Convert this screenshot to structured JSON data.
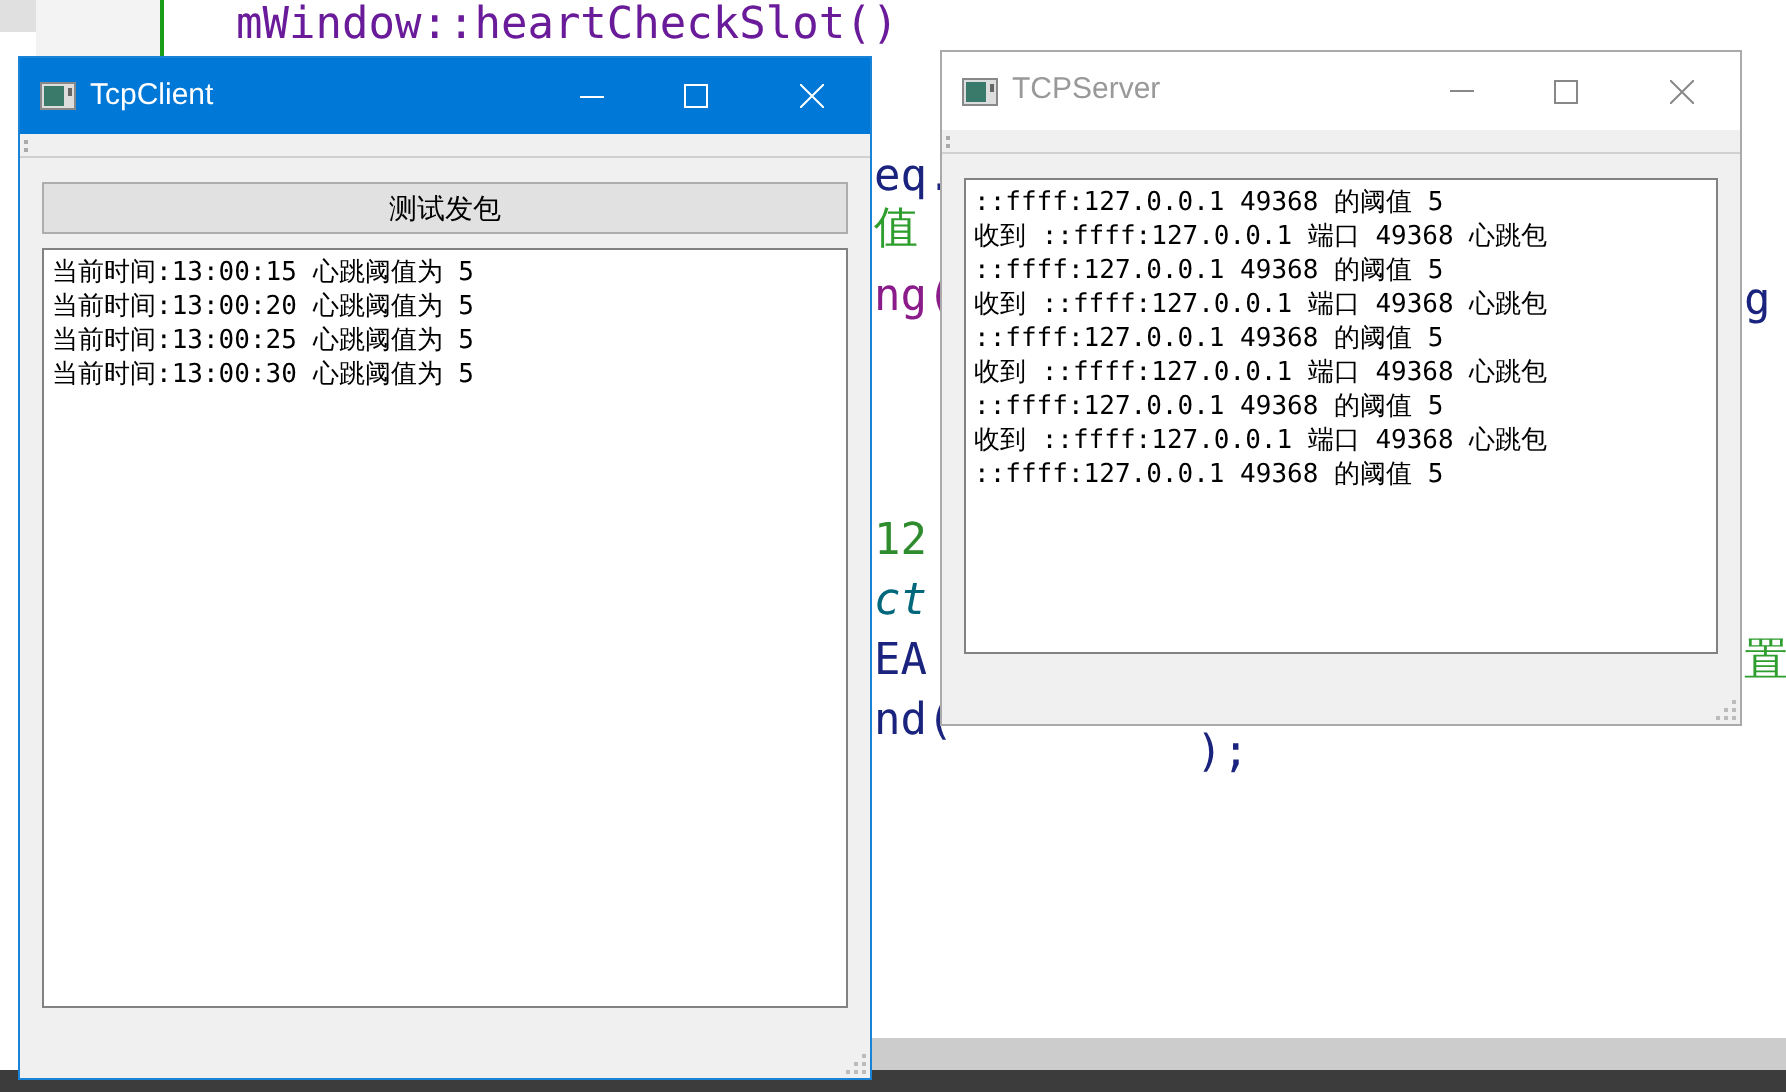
{
  "editor": {
    "code_fragments": [
      {
        "text": "mWindow::heartCheckSlot()",
        "color": "#6a1b9a",
        "italic": false
      },
      {
        "text": "eq.",
        "color": "#1a237e",
        "italic": false
      },
      {
        "text": "值",
        "color": "#2e9e2e",
        "italic": false
      },
      {
        "text": "ng(",
        "color": "#8b1a8b",
        "italic": false
      },
      {
        "text": "g",
        "color": "#1a237e",
        "italic": false
      },
      {
        "text": "12",
        "color": "#2e8b2e",
        "italic": false
      },
      {
        "text": "ct",
        "color": "#00677c",
        "italic": true
      },
      {
        "text": "EA",
        "color": "#1a237e",
        "italic": false
      },
      {
        "text": "置",
        "color": "#2e9e2e",
        "italic": false
      },
      {
        "text": "nd(",
        "color": "#1a237e",
        "italic": false
      },
      {
        "text": ");",
        "color": "#1a237e",
        "italic": false
      }
    ]
  },
  "windows": [
    {
      "title": "TcpClient",
      "active": true,
      "button": "测试发包",
      "log": [
        "当前时间:13:00:15 心跳阈值为 5",
        "当前时间:13:00:20 心跳阈值为 5",
        "当前时间:13:00:25 心跳阈值为 5",
        "当前时间:13:00:30 心跳阈值为 5"
      ]
    },
    {
      "title": "TCPServer",
      "active": false,
      "log": [
        "::ffff:127.0.0.1 49368 的阈值 5",
        "收到 ::ffff:127.0.0.1 端口 49368 心跳包",
        "::ffff:127.0.0.1 49368 的阈值 5",
        "收到 ::ffff:127.0.0.1 端口 49368 心跳包",
        "::ffff:127.0.0.1 49368 的阈值 5",
        "收到 ::ffff:127.0.0.1 端口 49368 心跳包",
        "::ffff:127.0.0.1 49368 的阈值 5",
        "收到 ::ffff:127.0.0.1 端口 49368 心跳包",
        "::ffff:127.0.0.1 49368 的阈值 5"
      ]
    }
  ]
}
